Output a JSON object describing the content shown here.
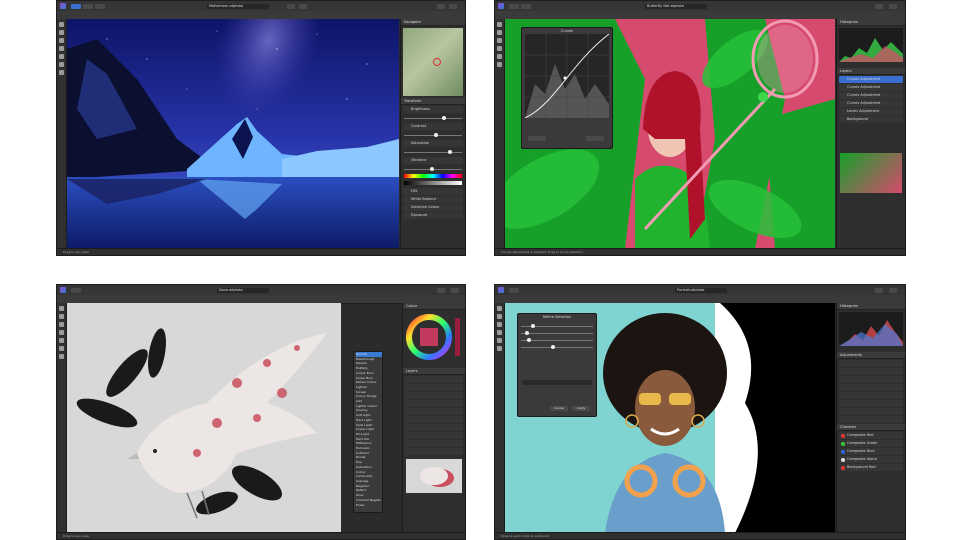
{
  "screenshots": [
    {
      "app": "Photo",
      "title": "Matterhorn.afphoto",
      "panel_tabs": [
        "Navigator",
        "Transform"
      ],
      "adjustments": [
        "Brightness",
        "Contrast",
        "Saturation",
        "Vibrance"
      ],
      "section_labels": [
        "HSL",
        "White Balance",
        "Selective Colour",
        "Exposure"
      ],
      "status": "Drag to pan view."
    },
    {
      "app": "Photo",
      "title": "Butterfly Net.afphoto",
      "dialog_title": "Curves",
      "layers": [
        "Curves Adjustment",
        "Curves Adjustment",
        "Curves Adjustment",
        "Curves Adjustment",
        "Levels Adjustment",
        "Background"
      ],
      "panel_tabs": [
        "Histogram",
        "Layers"
      ],
      "status": "Curves Adjustment 1 selected. Drag to move selection."
    },
    {
      "app": "Photo",
      "title": "Dove.afphoto",
      "blend_modes": [
        "Normal",
        "Passthrough",
        "Darken",
        "Multiply",
        "Colour Burn",
        "Linear Burn",
        "Darker Colour",
        "Lighten",
        "Screen",
        "Colour Dodge",
        "Add",
        "Lighter Colour",
        "Overlay",
        "Soft Light",
        "Hard Light",
        "Vivid Light",
        "Linear Light",
        "Pin Light",
        "Hard Mix",
        "Difference",
        "Exclusion",
        "Subtract",
        "Divide",
        "Hue",
        "Saturation",
        "Colour",
        "Luminosity",
        "Average",
        "Negation",
        "Reflect",
        "Glow",
        "Contrast Negate",
        "Erase"
      ],
      "panel_tabs": [
        "Colour",
        "Swatches",
        "Layers"
      ],
      "status": "Drag to pan view."
    },
    {
      "app": "Photo",
      "title": "Portrait.afphoto",
      "dialog_title": "Refine Selection",
      "dialog_buttons": [
        "Cancel",
        "Apply"
      ],
      "channels": [
        "Composite Red",
        "Composite Green",
        "Composite Blue",
        "Composite Alpha",
        "Background Red"
      ],
      "panel_tabs": [
        "Histogram",
        "Adjustments",
        "Channels"
      ],
      "status": "Drag to paint. Click to add point."
    }
  ],
  "colors": {
    "chrome": "#2b2b2b",
    "accent": "#3a7bd5",
    "night_sky": "#1b2a8c",
    "jungle_green": "#1fa02e",
    "dove_bg": "#d8d8d8",
    "teal_wall": "#7fd3d0"
  }
}
